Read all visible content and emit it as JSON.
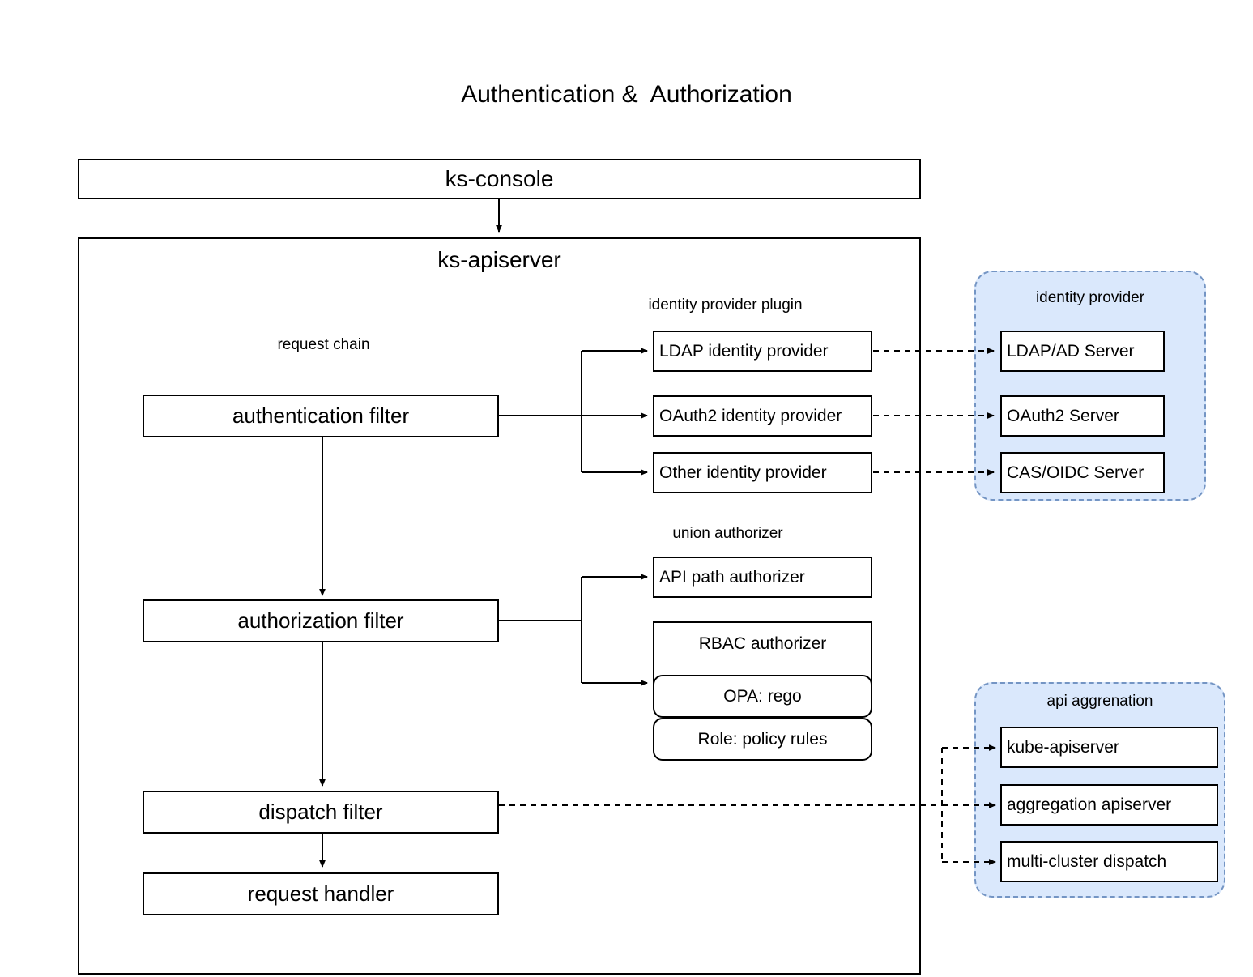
{
  "diagram": {
    "title": "Authentication &  Authorization",
    "console": {
      "label": "ks-console"
    },
    "apiserver": {
      "label": "ks-apiserver"
    },
    "request_chain": {
      "title": "request chain",
      "steps": [
        {
          "label": "authentication filter"
        },
        {
          "label": "authorization filter"
        },
        {
          "label": "dispatch filter"
        },
        {
          "label": "request handler"
        }
      ]
    },
    "identity_provider_plugin": {
      "title": "identity provider plugin",
      "items": [
        {
          "label": "LDAP identity provider"
        },
        {
          "label": "OAuth2 identity provider"
        },
        {
          "label": "Other identity provider"
        }
      ]
    },
    "identity_provider": {
      "title": "identity provider",
      "items": [
        {
          "label": "LDAP/AD Server"
        },
        {
          "label": "OAuth2 Server"
        },
        {
          "label": "CAS/OIDC Server"
        }
      ]
    },
    "union_authorizer": {
      "title": "union authorizer",
      "api_path_authorizer": {
        "label": "API path authorizer"
      },
      "rbac_authorizer": {
        "label": "RBAC authorizer"
      },
      "opa_rego": {
        "label": "OPA: rego"
      },
      "role_policy_rules": {
        "label": "Role: policy rules"
      }
    },
    "api_aggregation": {
      "title": "api aggrenation",
      "items": [
        {
          "label": "kube-apiserver"
        },
        {
          "label": "aggregation apiserver"
        },
        {
          "label": "multi-cluster  dispatch"
        }
      ]
    },
    "colors": {
      "orange_fill": "#FDEECD",
      "orange_border": "#E5B84B",
      "blue_fill": "#DAE8FC",
      "blue_border": "#7495C4",
      "stroke": "#000000",
      "box_fill": "#FFFFFF"
    }
  }
}
